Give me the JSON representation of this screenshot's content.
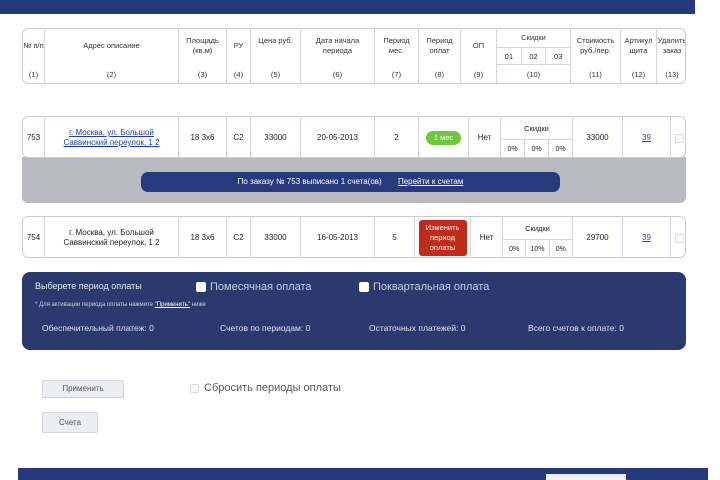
{
  "header": {
    "columns": [
      {
        "name": "№ п/п",
        "num": "(1)"
      },
      {
        "name": "Адрес описание",
        "num": "(2)"
      },
      {
        "name": "Площадь (кв.м)",
        "num": "(3)"
      },
      {
        "name": "РУ",
        "num": "(4)"
      },
      {
        "name": "Цена руб.",
        "num": "(5)"
      },
      {
        "name": "Дата начала периода",
        "num": "(6)"
      },
      {
        "name": "Период мес.",
        "num": "(7)"
      },
      {
        "name": "Период оплат",
        "num": "(8)"
      },
      {
        "name": "ОП",
        "num": "(9)"
      },
      {
        "name": "Скидки",
        "num": "(10)",
        "sub": [
          "01",
          "02",
          "03"
        ]
      },
      {
        "name": "Стоимость руб./пер.",
        "num": "(11)"
      },
      {
        "name": "Артикул щита",
        "num": "(12)"
      },
      {
        "name": "Удалить заказ",
        "num": "(13)"
      }
    ]
  },
  "orders": [
    {
      "id": "753",
      "address": "г. Москва, ул. Большой Саввинский переулок, 1 2",
      "area": "18 3х6",
      "ru": "С2",
      "price": "33000",
      "start_date": "20-05-2013",
      "period": "2",
      "pay_period": "1 мес",
      "op": "Нет",
      "discount_title": "Скидки",
      "discounts": [
        "0%",
        "0%",
        "0%"
      ],
      "cost": "33000",
      "article": "39"
    },
    {
      "id": "754",
      "address": "г. Москва, ул. Большой Саввинский переулок, 1 2",
      "area": "18 3х6",
      "ru": "С2",
      "price": "33000",
      "start_date": "16-05-2013",
      "period": "5",
      "pay_period_button": "Изменить период оплаты",
      "op": "Нет",
      "discount_title": "Скидки",
      "discounts": [
        "0%",
        "10%",
        "0%"
      ],
      "cost": "29700",
      "article": "39"
    }
  ],
  "invoice_bar": {
    "text": "По заказу № 753 выписано 1 счета(ов)",
    "link": "Перейти к счетам"
  },
  "payment_panel": {
    "title": "Выберете период оплаты",
    "option_monthly": "Помесячная оплата",
    "option_quarterly": "Поквартальная оплата",
    "note_prefix": "* Для активации периода оплаты нажмите ",
    "note_link": "\"Применить\"",
    "note_suffix": " ниже",
    "deposit": "Обеспечительный платеж: 0",
    "periods_count": "Счетов по периодам: 0",
    "remaining": "Остаточных платежей: 0",
    "total": "Всего счетов к оплате: 0"
  },
  "actions": {
    "apply": "Применить",
    "reset": "Сбросить периоды оплаты",
    "invoices": "Счета"
  }
}
